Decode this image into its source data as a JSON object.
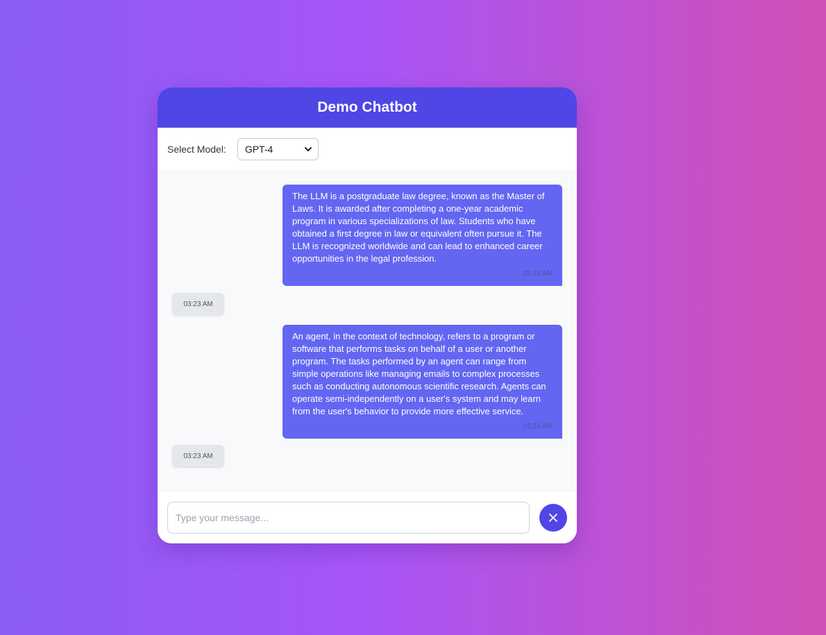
{
  "app": {
    "title": "Demo Chatbot"
  },
  "model_selector": {
    "label": "Select Model:",
    "selected": "GPT-4"
  },
  "messages": [
    {
      "role": "user",
      "text": "The LLM is a postgraduate law degree, known as the Master of Laws. It is awarded after completing a one-year academic program in various specializations of law. Students who have obtained a first degree in law or equivalent often pursue it. The LLM is recognized worldwide and can lead to enhanced career opportunities in the legal profession.",
      "time": "03:23 AM"
    },
    {
      "role": "bot",
      "text": "",
      "time": "03:23 AM"
    },
    {
      "role": "user",
      "text": "An agent, in the context of technology, refers to a program or software that performs tasks on behalf of a user or another program. The tasks performed by an agent can range from simple operations like managing emails to complex processes such as conducting autonomous scientific research. Agents can operate semi-independently on a user's system and may learn from the user's behavior to provide more effective service.",
      "time": "03:23 AM"
    },
    {
      "role": "bot",
      "text": "",
      "time": "03:23 AM"
    }
  ],
  "input": {
    "placeholder": "Type your message...",
    "value": ""
  },
  "send_button": {
    "icon": "close-icon"
  },
  "colors": {
    "header": "#4f46e5",
    "user_bubble": "#6366f1",
    "bot_bubble": "#e5e7eb",
    "background_start": "#8b5cf6",
    "background_end": "#d04fb5"
  }
}
